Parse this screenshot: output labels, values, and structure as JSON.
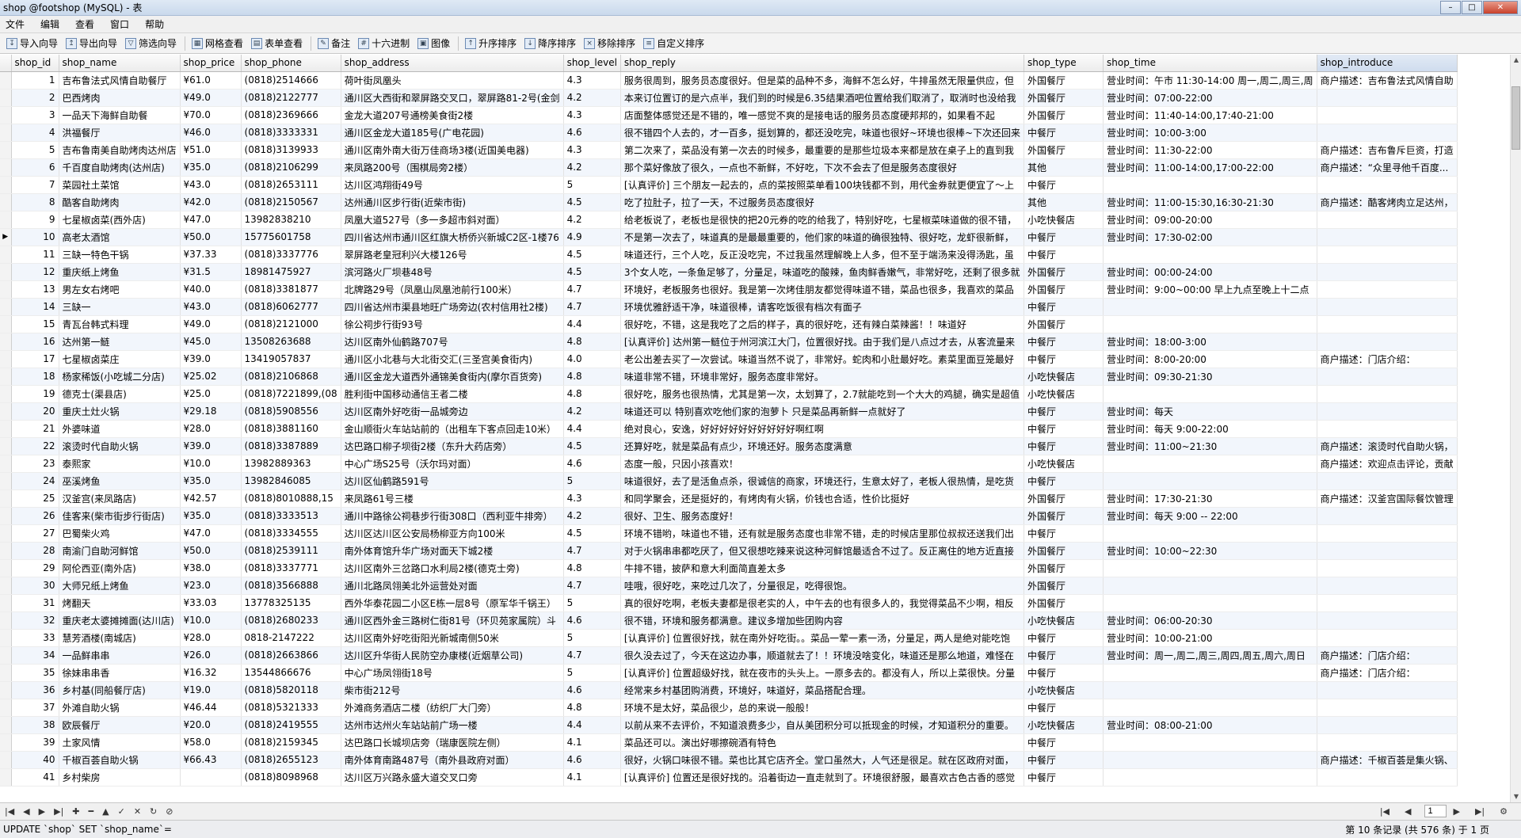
{
  "window": {
    "title": "shop @footshop (MySQL) - 表"
  },
  "menu": [
    "文件",
    "编辑",
    "查看",
    "窗口",
    "帮助"
  ],
  "toolbar": [
    {
      "label": "导入向导",
      "icon": "import-icon"
    },
    {
      "label": "导出向导",
      "icon": "export-icon"
    },
    {
      "label": "筛选向导",
      "icon": "filter-icon"
    },
    {
      "label": "网格查看",
      "icon": "grid-icon"
    },
    {
      "label": "表单查看",
      "icon": "form-icon"
    },
    {
      "label": "备注",
      "icon": "note-icon"
    },
    {
      "label": "十六进制",
      "icon": "hex-icon"
    },
    {
      "label": "图像",
      "icon": "image-icon"
    },
    {
      "label": "升序排序",
      "icon": "sort-asc-icon"
    },
    {
      "label": "降序排序",
      "icon": "sort-desc-icon"
    },
    {
      "label": "移除排序",
      "icon": "remove-sort-icon"
    },
    {
      "label": "自定义排序",
      "icon": "custom-sort-icon"
    }
  ],
  "columns": [
    "shop_id",
    "shop_name",
    "shop_price",
    "shop_phone",
    "shop_address",
    "shop_level",
    "shop_reply",
    "shop_type",
    "shop_time",
    "shop_introduce"
  ],
  "rows": [
    [
      "1",
      "吉布鲁法式风情自助餐厅",
      "¥61.0",
      "(0818)2514666",
      "荷叶街凤凰头",
      "4.3",
      "服务很周到，服务员态度很好。但是菜的品种不多，海鲜不怎么好，牛排虽然无限量供应，但",
      "外国餐厅",
      "营业时间：午市 11:30-14:00 周一,周二,周三,周",
      "商户描述：吉布鲁法式风情自助"
    ],
    [
      "2",
      "巴西烤肉",
      "¥49.0",
      "(0818)2122777",
      "通川区大西街和翠屏路交叉口，翠屏路81-2号(金剑",
      "4.2",
      "本来订位置订的是六点半，我们到的时候是6.35结果酒吧位置给我们取消了，取消时也没给我",
      "外国餐厅",
      "营业时间：07:00-22:00",
      ""
    ],
    [
      "3",
      "一品天下海鲜自助餐",
      "¥70.0",
      "(0818)2369666",
      "金龙大道207号通榜美食街2楼",
      "4.3",
      "店面整体感觉还是不错的，唯一感觉不爽的是接电话的服务员态度硬邦邦的，如果看不起",
      "外国餐厅",
      "营业时间：11:40-14:00,17:40-21:00",
      ""
    ],
    [
      "4",
      "洪福餐厅",
      "¥46.0",
      "(0818)3333331",
      "通川区金龙大道185号(广电花园)",
      "4.6",
      "很不错四个人去的，才一百多，挺划算的，都还没吃完，味道也很好~环境也很棒~下次还回来",
      "中餐厅",
      "营业时间：10:00-3:00",
      ""
    ],
    [
      "5",
      "吉布鲁南美自助烤肉达州店",
      "¥51.0",
      "(0818)3139933",
      "通川区南外南大街万佳商场3楼(近国美电器)",
      "4.3",
      "第二次来了，菜品没有第一次去的时候多，最重要的是那些垃圾本来都是放在桌子上的直到我",
      "外国餐厅",
      "营业时间：11:30-22:00",
      "商户描述：吉布鲁斥巨资，打造"
    ],
    [
      "6",
      "千百度自助烤肉(达州店)",
      "¥35.0",
      "(0818)2106299",
      "来凤路200号（围棋局旁2楼）",
      "4.2",
      "那个菜好像放了很久，一点也不新鲜，不好吃，下次不会去了但是服务态度很好",
      "其他",
      "营业时间：11:00-14:00,17:00-22:00",
      "商户描述：“众里寻他千百度..."
    ],
    [
      "7",
      "菜园社土菜馆",
      "¥43.0",
      "(0818)2653111",
      "达川区鸿翔街49号",
      "5",
      "[认真评价] 三个朋友一起去的，点的菜按照菜单看100块钱都不到，用代金券就更便宜了～上",
      "中餐厅",
      "",
      ""
    ],
    [
      "8",
      "酷客自助烤肉",
      "¥42.0",
      "(0818)2150567",
      "达州通川区步行街(近柴市街)",
      "4.5",
      "吃了拉肚子，拉了一天，不过服务员态度很好",
      "其他",
      "营业时间：11:00-15:30,16:30-21:30",
      "商户描述：酷客烤肉立足达州，"
    ],
    [
      "9",
      "七星椒卤菜(西外店)",
      "¥47.0",
      "13982838210",
      "凤凰大道527号（多一多超市斜对面）",
      "4.2",
      "给老板说了，老板也是很快的把20元券的吃的给我了，特别好吃，七星椒菜味道做的很不错，",
      "小吃快餐店",
      "营业时间：09:00-20:00",
      ""
    ],
    [
      "10",
      "高老太酒馆",
      "¥50.0",
      "15775601758",
      "四川省达州市通川区红旗大桥侨兴新城C2区-1楼76",
      "4.9",
      "不是第一次去了，味道真的是最最重要的，他们家的味道的确很独特、很好吃，龙虾很新鲜，",
      "中餐厅",
      "营业时间：17:30-02:00",
      ""
    ],
    [
      "11",
      "三缺一特色干锅",
      "¥37.33",
      "(0818)3337776",
      "翠屏路老皇冠利兴大楼126号",
      "4.5",
      "味道还行，三个人吃，反正没吃完，不过我虽然理解晚上人多，但不至于端汤来没得汤匙，虽",
      "中餐厅",
      "",
      ""
    ],
    [
      "12",
      "重庆纸上烤鱼",
      "¥31.5",
      "18981475927",
      "滨河路火厂坝巷48号",
      "4.5",
      "3个女人吃，一条鱼足够了，分量足，味道吃的酸辣，鱼肉鲜香嫩气，非常好吃，还剩了很多就",
      "外国餐厅",
      "营业时间：00:00-24:00",
      ""
    ],
    [
      "13",
      "男左女右烤吧",
      "¥40.0",
      "(0818)3381877",
      "北牌路29号（凤凰山凤凰池前行100米）",
      "4.7",
      "环境好，老板服务也很好。我是第一次烤佳朋友都觉得味道不错，菜品也很多，我喜欢的菜品",
      "外国餐厅",
      "营业时间：9:00~00:00 早上九点至晚上十二点",
      ""
    ],
    [
      "14",
      "三缺一",
      "¥43.0",
      "(0818)6062777",
      "四川省达州市渠县地旺广场旁边(农村信用社2楼)",
      "4.7",
      "环境优雅舒适干净，味道很棒，请客吃饭很有档次有面子",
      "中餐厅",
      "",
      ""
    ],
    [
      "15",
      "青瓦台韩式料理",
      "¥49.0",
      "(0818)2121000",
      "徐公祠步行街93号",
      "4.4",
      "很好吃，不错，这是我吃了之后的样子，真的很好吃，还有辣白菜辣酱！！味道好",
      "外国餐厅",
      "",
      ""
    ],
    [
      "16",
      "达州第一鲢",
      "¥45.0",
      "13508263688",
      "达川区南外仙鹤路707号",
      "4.8",
      "[认真评价] 达州第一鲢位于州河滨江大门，位置很好找。由于我们是八点过才去，从客流量来",
      "中餐厅",
      "营业时间：18:00-3:00",
      ""
    ],
    [
      "17",
      "七星椒卤菜庄",
      "¥39.0",
      "13419057837",
      "通川区小北巷与大北街交汇(三圣宫美食街内)",
      "4.0",
      "老公出差去买了一次尝试。味道当然不说了，非常好。蛇肉和小肚最好吃。素菜里面豆笼最好",
      "中餐厅",
      "营业时间：8:00-20:00",
      "商户描述：门店介绍："
    ],
    [
      "18",
      "杨家稀饭(小吃城二分店)",
      "¥25.02",
      "(0818)2106868",
      "通川区金龙大道西外通锦美食街内(摩尔百货旁)",
      "4.8",
      "味道非常不错，环境非常好，服务态度非常好。",
      "小吃快餐店",
      "营业时间：09:30-21:30",
      ""
    ],
    [
      "19",
      "德克士(渠县店)",
      "¥25.0",
      "(0818)7221899,(08",
      "胜利街中国移动通信王者二楼",
      "4.8",
      "很好吃，服务也很热情，尤其是第一次，太划算了，2.7就能吃到一个大大的鸡腿，确实是超值",
      "小吃快餐店",
      "",
      ""
    ],
    [
      "20",
      "重庆土灶火锅",
      "¥29.18",
      "(0818)5908556",
      "达川区南外好吃街一品城旁边",
      "4.2",
      "味道还可以 特别喜欢吃他们家的泡萝卜 只是菜品再新鲜一点就好了",
      "中餐厅",
      "营业时间：每天",
      ""
    ],
    [
      "21",
      "外婆味道",
      "¥28.0",
      "(0818)3881160",
      "金山顺街火车站站前的（出租车下客点回走10米）",
      "4.4",
      "绝对良心，安逸，好好好好好好好好好好啊红啊",
      "中餐厅",
      "营业时间：每天 9:00-22:00",
      ""
    ],
    [
      "22",
      "滚烫时代自助火锅",
      "¥39.0",
      "(0818)3387889",
      "达巴路口柳子坝街2楼（东升大药店旁）",
      "4.5",
      "还算好吃，就是菜品有点少，环境还好。服务态度满意",
      "中餐厅",
      "营业时间：11:00~21:30",
      "商户描述：滚烫时代自助火锅，"
    ],
    [
      "23",
      "泰熙家",
      "¥10.0",
      "13982889363",
      "中心广场S25号（沃尔玛对面）",
      "4.6",
      "态度一般，只因小孩喜欢！",
      "小吃快餐店",
      "",
      "商户描述：欢迎点击评论，贡献"
    ],
    [
      "24",
      "巫溪烤鱼",
      "¥35.0",
      "13982846085",
      "达川区仙鹤路591号",
      "5",
      "味道很好，去了是活鱼点杀，很诚信的商家，环境还行，生意太好了，老板人很热情，是吃货",
      "中餐厅",
      "",
      ""
    ],
    [
      "25",
      "汉釜宫(来凤路店)",
      "¥42.57",
      "(0818)8010888,15",
      "来凤路61号三楼",
      "4.3",
      "和同学聚会，还是挺好的，有烤肉有火锅，价钱也合适，性价比挺好",
      "外国餐厅",
      "营业时间：17:30-21:30",
      "商户描述：汉釜宫国际餐饮管理"
    ],
    [
      "26",
      "佳客来(柴市街步行街店)",
      "¥35.0",
      "(0818)3333513",
      "通川中路徐公祠巷步行街308口（西利亚牛排旁）",
      "4.2",
      "很好、卫生、服务态度好！",
      "外国餐厅",
      "营业时间：每天 9:00 -- 22:00",
      ""
    ],
    [
      "27",
      "巴蜀柴火鸡",
      "¥47.0",
      "(0818)3334555",
      "达川区达川区公安局杨柳亚方向100米",
      "4.5",
      "环境不错哟，味道也不错，还有就是服务态度也非常不错，走的时候店里那位叔叔还送我们出",
      "中餐厅",
      "",
      ""
    ],
    [
      "28",
      "南渝门自助河鲜馆",
      "¥50.0",
      "(0818)2539111",
      "南外体育馆升华广场对面天下城2楼",
      "4.7",
      "对于火锅串串都吃厌了，但又很想吃辣来说这种河鲜馆最适合不过了。反正离住的地方近直接",
      "外国餐厅",
      "营业时间：10:00~22:30",
      ""
    ],
    [
      "29",
      "阿伦西亚(南外店)",
      "¥38.0",
      "(0818)3337771",
      "达川区南外三岔路口水利局2楼(德克士旁)",
      "4.8",
      "牛排不错，披萨和意大利面简直差太多",
      "外国餐厅",
      "",
      ""
    ],
    [
      "30",
      "大师兄纸上烤鱼",
      "¥23.0",
      "(0818)3566888",
      "通川北路凤翎美北外运营处对面",
      "4.7",
      "哇哦，很好吃，来吃过几次了，分量很足，吃得很饱。",
      "外国餐厅",
      "",
      ""
    ],
    [
      "31",
      "烤翻天",
      "¥33.03",
      "13778325135",
      "西外华泰花园二小区E栋一层8号（原军华千锅王）",
      "5",
      "真的很好吃啊，老板夫妻都是很老实的人，中午去的也有很多人的，我觉得菜品不少啊，相反",
      "外国餐厅",
      "",
      ""
    ],
    [
      "32",
      "重庆老太婆摊摊面(达川店)",
      "¥10.0",
      "(0818)2680233",
      "通川区西外金三路树仁街81号（环贝苑家属院）斗",
      "4.6",
      "很不错，环境和服务都满意。建议多增加些团购内容",
      "小吃快餐店",
      "营业时间：06:00-20:30",
      ""
    ],
    [
      "33",
      "慧芳酒楼(南城店)",
      "¥28.0",
      "0818-2147222",
      "达川区南外好吃街阳光新城南侧50米",
      "5",
      "[认真评价] 位置很好找，就在南外好吃街。。菜品一荤一素一汤，分量足，两人是绝对能吃饱",
      "中餐厅",
      "营业时间：10:00-21:00",
      ""
    ],
    [
      "34",
      "一品鲜串串",
      "¥26.0",
      "(0818)2663866",
      "达川区升华街人民防空办康楼(近烟草公司)",
      "4.7",
      "很久没去过了，今天在这边办事，顺道就去了！！环境没啥变化，味道还是那么地道，难怪在",
      "中餐厅",
      "营业时间：周一,周二,周三,周四,周五,周六,周日",
      "商户描述：门店介绍："
    ],
    [
      "35",
      "徐妹串串香",
      "¥16.32",
      "13544866676",
      "中心广场凤翎街18号",
      "5",
      "[认真评价] 位置超级好找，就在夜市的头头上。一原多去的。都没有人，所以上菜很快。分量",
      "中餐厅",
      "",
      "商户描述：门店介绍："
    ],
    [
      "36",
      "乡村基(同船餐厅店)",
      "¥19.0",
      "(0818)5820118",
      "柴市街212号",
      "4.6",
      "经常来乡村基团购消费，环境好，味道好，菜品搭配合理。",
      "小吃快餐店",
      "",
      ""
    ],
    [
      "37",
      "外滩自助火锅",
      "¥46.44",
      "(0818)5321333",
      "外滩商务酒店二楼（纺织厂大门旁）",
      "4.8",
      "环境不是太好，菜品很少，总的来说一般般！",
      "中餐厅",
      "",
      ""
    ],
    [
      "38",
      "欧辰餐厅",
      "¥20.0",
      "(0818)2419555",
      "达州市达州火车站站前广场一楼",
      "4.4",
      "以前从来不去评价，不知道浪费多少，自从美团积分可以抵现金的时候，才知道积分的重要。",
      "小吃快餐店",
      "营业时间：08:00-21:00",
      ""
    ],
    [
      "39",
      "土家风情",
      "¥58.0",
      "(0818)2159345",
      "达巴路口长城坝店旁（瑞康医院左侧）",
      "4.1",
      "菜品还可以。演出好哪擦碗酒有特色",
      "中餐厅",
      "",
      ""
    ],
    [
      "40",
      "千椒百荟自助火锅",
      "¥66.43",
      "(0818)2655123",
      "南外体育南路487号（南外县政府对面）",
      "4.6",
      "很好，火锅口味很不错。菜也比其它店齐全。堂口虽然大，人气还是很足。就在区政府对面，",
      "中餐厅",
      "",
      "商户描述：千椒百荟是集火锅、"
    ],
    [
      "41",
      "乡村柴房",
      "",
      "(0818)8098968",
      "达川区万兴路永盛大道交叉口旁",
      "4.1",
      "[认真评价] 位置还是很好找的。沿着街边一直走就到了。环境很舒服，最喜欢古色古香的感觉",
      "中餐厅",
      "",
      ""
    ]
  ],
  "current_row": 10,
  "nav": {
    "page": "1"
  },
  "status": {
    "sql": "UPDATE `shop` SET `shop_name`=",
    "records": "第 10 条记录 (共 576 条) 于 1 页"
  }
}
